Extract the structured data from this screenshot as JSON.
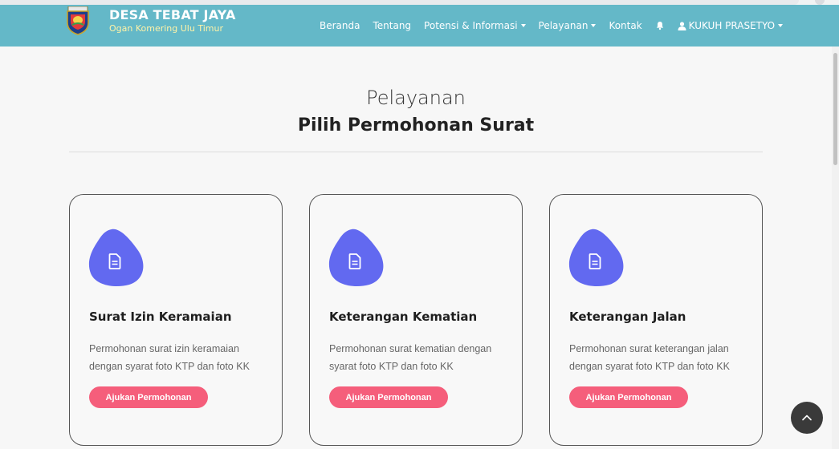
{
  "navbar": {
    "brand_title": "DESA TEBAT JAYA",
    "brand_subtitle": "Ogan Komering Ulu Timur",
    "items": [
      {
        "label": "Beranda",
        "dropdown": false
      },
      {
        "label": "Tentang",
        "dropdown": false
      },
      {
        "label": "Potensi & Informasi",
        "dropdown": true
      },
      {
        "label": "Pelayanan",
        "dropdown": true
      },
      {
        "label": "Kontak",
        "dropdown": false
      }
    ],
    "notification_icon": "bell-icon",
    "user_icon": "user-icon",
    "user_name": "KUKUH PRASETYO"
  },
  "page": {
    "subtitle": "Pelayanan",
    "title": "Pilih Permohonan Surat"
  },
  "cards": [
    {
      "icon": "document-icon",
      "title": "Surat Izin Keramaian",
      "description": "Permohonan surat izin keramaian dengan syarat foto KTP dan foto KK",
      "button_label": "Ajukan Permohonan"
    },
    {
      "icon": "document-icon",
      "title": "Keterangan Kematian",
      "description": "Permohonan surat kematian dengan syarat foto KTP dan foto KK",
      "button_label": "Ajukan Permohonan"
    },
    {
      "icon": "document-icon",
      "title": "Keterangan Jalan",
      "description": "Permohonan surat keterangan jalan dengan syarat foto KTP dan foto KK",
      "button_label": "Ajukan Permohonan"
    }
  ],
  "scroll_top_icon": "chevron-up-icon",
  "colors": {
    "navbar": "#64b8c8",
    "brand_subtitle": "#fff3a8",
    "icon_blob": "#6269f0",
    "button": "#f55e7b",
    "scroll_top": "#3a3a3a"
  }
}
